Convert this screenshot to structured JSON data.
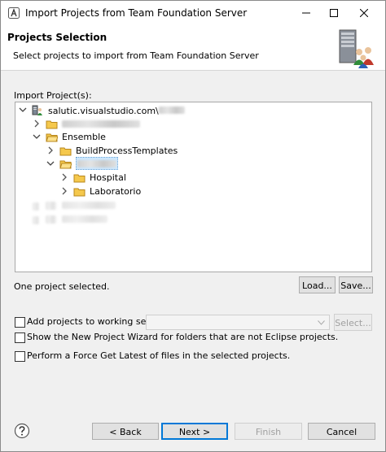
{
  "window": {
    "title": "Import Projects from Team Foundation Server"
  },
  "header": {
    "title": "Projects Selection",
    "subtitle": "Select projects to import from Team Foundation Server"
  },
  "tree": {
    "label": "Import Project(s):",
    "server": "salutic.visualstudio.com\\",
    "items": [
      "Ensemble",
      "BuildProcessTemplates",
      "Hospital",
      "Laboratorio"
    ]
  },
  "status": {
    "text": "One project selected."
  },
  "buttons": {
    "load": "Load...",
    "save": "Save...",
    "select": "Select...",
    "back": "< Back",
    "next": "Next >",
    "finish": "Finish",
    "cancel": "Cancel"
  },
  "options": {
    "working_set": "Add projects to working set:",
    "new_project_wizard": "Show the New Project Wizard for folders that are not Eclipse projects.",
    "force_get": "Perform a Force Get Latest of files in the selected projects."
  },
  "colors": {
    "selection": "#cce8ff",
    "default_button_border": "#0078d7"
  }
}
